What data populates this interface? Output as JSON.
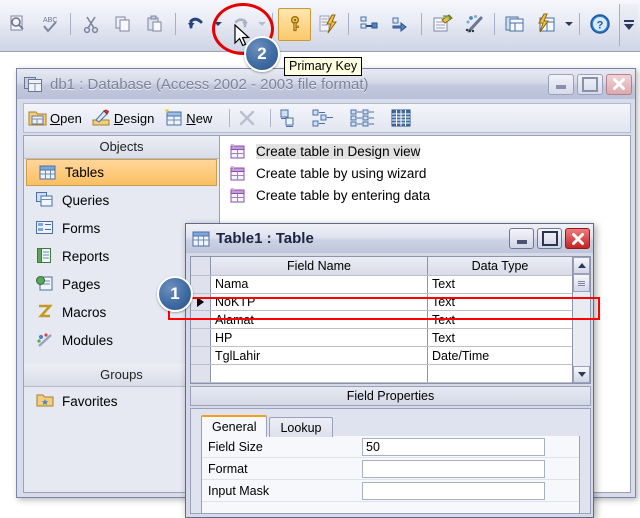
{
  "toolbar": {
    "buttons": [
      {
        "name": "print-preview-icon",
        "label": "Print Preview"
      },
      {
        "name": "spelling-icon",
        "label": "Spelling"
      },
      {
        "name": "cut-icon",
        "label": "Cut"
      },
      {
        "name": "copy-icon",
        "label": "Copy"
      },
      {
        "name": "paste-icon",
        "label": "Paste"
      },
      {
        "name": "undo-icon",
        "label": "Undo"
      },
      {
        "name": "redo-icon",
        "label": "Redo"
      },
      {
        "name": "primary-key-icon",
        "label": "Primary Key"
      },
      {
        "name": "indexes-icon",
        "label": "Indexes"
      },
      {
        "name": "insert-rows-icon",
        "label": "Insert Rows"
      },
      {
        "name": "delete-rows-icon",
        "label": "Delete Rows"
      },
      {
        "name": "properties-icon",
        "label": "Properties"
      },
      {
        "name": "build-icon",
        "label": "Build"
      },
      {
        "name": "database-window-icon",
        "label": "Database Window"
      },
      {
        "name": "new-object-icon",
        "label": "New Object"
      },
      {
        "name": "help-icon",
        "label": "Microsoft Office Access Help"
      }
    ],
    "tooltip": "Primary Key"
  },
  "annotations": [
    {
      "id": "1",
      "number": "1"
    },
    {
      "id": "2",
      "number": "2"
    }
  ],
  "database_window": {
    "title": "db1 : Database (Access 2002 - 2003 file format)",
    "title_icon": "database-icon",
    "window_buttons": {
      "minimize": "Minimize",
      "restore": "Restore",
      "close": "Close"
    },
    "toolbar": {
      "open": "Open",
      "design": "Design",
      "new": "New",
      "delete_icon": "delete-icon",
      "large_icons_icon": "large-icons-view-icon",
      "small_icons_icon": "small-icons-view-icon",
      "list_icon": "list-view-icon",
      "details_icon": "details-view-icon"
    },
    "objects_header": "Objects",
    "objects": [
      {
        "label": "Tables",
        "icon": "tables-icon",
        "selected": true
      },
      {
        "label": "Queries",
        "icon": "queries-icon",
        "selected": false
      },
      {
        "label": "Forms",
        "icon": "forms-icon",
        "selected": false
      },
      {
        "label": "Reports",
        "icon": "reports-icon",
        "selected": false
      },
      {
        "label": "Pages",
        "icon": "pages-icon",
        "selected": false
      },
      {
        "label": "Macros",
        "icon": "macros-icon",
        "selected": false
      },
      {
        "label": "Modules",
        "icon": "modules-icon",
        "selected": false
      }
    ],
    "groups_header": "Groups",
    "groups": [
      {
        "label": "Favorites",
        "icon": "favorites-folder-icon"
      }
    ],
    "create_items": [
      {
        "label": "Create table in Design view",
        "icon": "new-table-icon",
        "highlighted": true
      },
      {
        "label": "Create table by using wizard",
        "icon": "new-table-icon",
        "highlighted": false
      },
      {
        "label": "Create table by entering data",
        "icon": "new-table-icon",
        "highlighted": false
      }
    ]
  },
  "table_window": {
    "title": "Table1 : Table",
    "title_icon": "table-design-icon",
    "window_buttons": {
      "minimize": "Minimize",
      "restore": "Restore",
      "close": "Close"
    },
    "grid": {
      "columns": [
        "Field Name",
        "Data Type"
      ],
      "rows": [
        {
          "field_name": "Nama",
          "data_type": "Text",
          "current": false
        },
        {
          "field_name": "NoKTP",
          "data_type": "Text",
          "current": true
        },
        {
          "field_name": "Alamat",
          "data_type": "Text",
          "current": false
        },
        {
          "field_name": "HP",
          "data_type": "Text",
          "current": false
        },
        {
          "field_name": "TglLahir",
          "data_type": "Date/Time",
          "current": false
        },
        {
          "field_name": "",
          "data_type": "",
          "current": false
        }
      ]
    },
    "field_properties_label": "Field Properties",
    "tabs": [
      {
        "label": "General",
        "active": true
      },
      {
        "label": "Lookup",
        "active": false
      }
    ],
    "properties": [
      {
        "name": "Field Size",
        "value": "50"
      },
      {
        "name": "Format",
        "value": ""
      },
      {
        "name": "Input Mask",
        "value": ""
      }
    ]
  },
  "colors": {
    "accent_orange": "#fbbf63",
    "highlight_red": "#ff0000",
    "annotation_blue": "#3f6ca3",
    "tooltip_bg": "#ffffe1"
  }
}
